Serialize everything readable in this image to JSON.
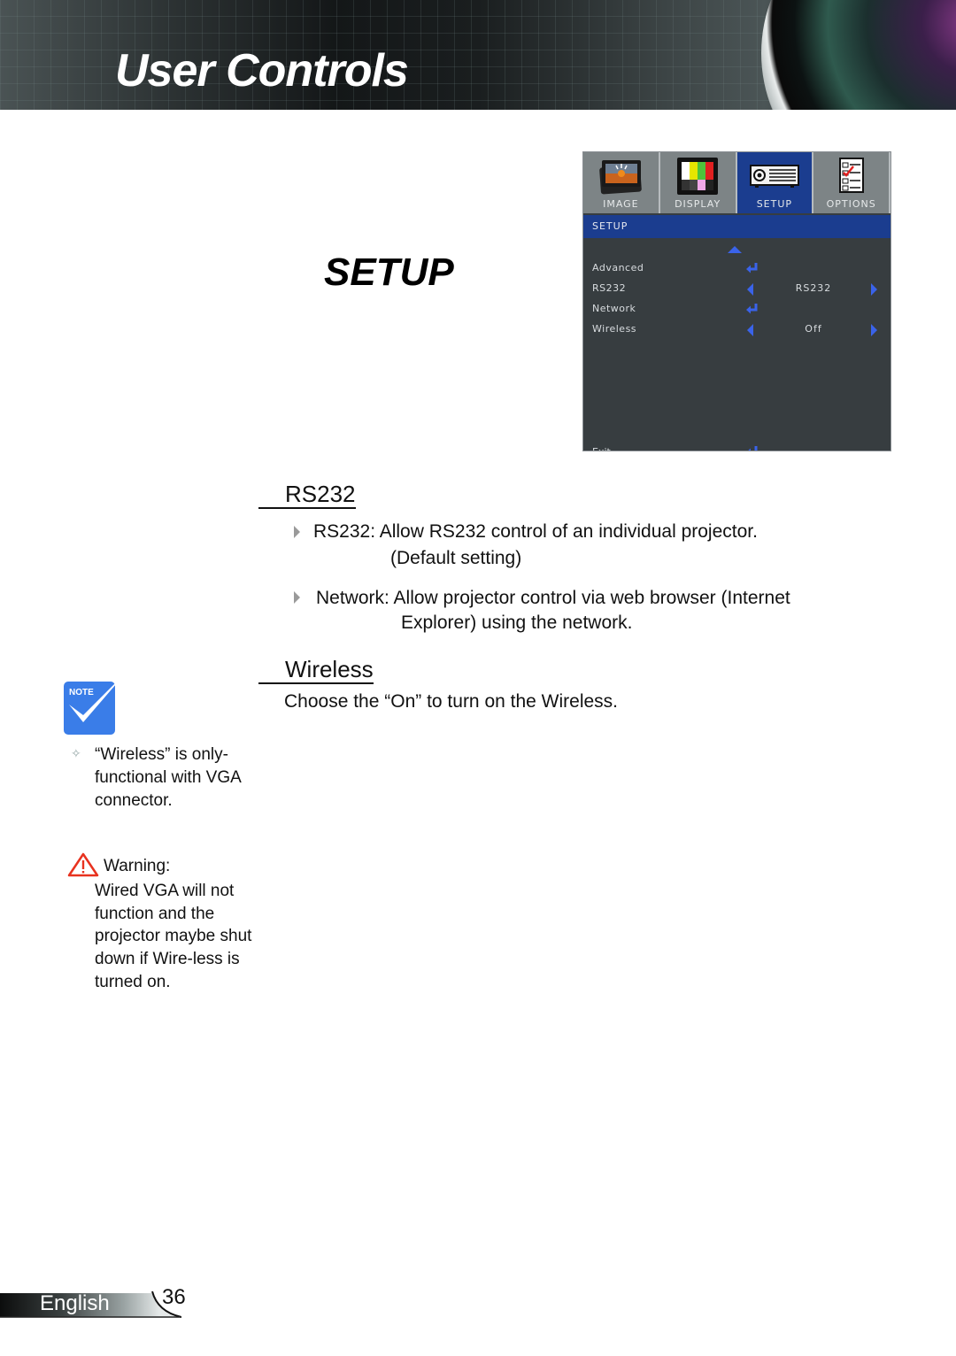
{
  "header": {
    "title": "User Controls"
  },
  "section": {
    "title": "SETUP"
  },
  "osd": {
    "tabs": [
      {
        "label": "IMAGE",
        "icon": "image-icon",
        "active": false
      },
      {
        "label": "DISPLAY",
        "icon": "display-icon",
        "active": false
      },
      {
        "label": "SETUP",
        "icon": "projector-icon",
        "active": true
      },
      {
        "label": "OPTIONS",
        "icon": "checklist-icon",
        "active": false
      }
    ],
    "title_bar": "SETUP",
    "rows": [
      {
        "label": "Advanced",
        "control": "enter"
      },
      {
        "label": "RS232",
        "control": "select",
        "value": "RS232"
      },
      {
        "label": "Network",
        "control": "enter"
      },
      {
        "label": "Wireless",
        "control": "select",
        "value": "Off"
      }
    ],
    "exit_label": "Exit",
    "accent_color": "#1b3d8f",
    "arrow_color": "#3a63ea"
  },
  "rs232": {
    "heading": "RS232",
    "items": [
      {
        "line1": "RS232: Allow RS232 control of an individual projector.",
        "line2": "(Default setting)"
      },
      {
        "line1": "Network: Allow projector control via web browser (Internet",
        "line2": "Explorer) using the network."
      }
    ]
  },
  "wireless": {
    "heading": "Wireless",
    "text": "Choose the “On” to turn on the Wireless."
  },
  "note": {
    "badge": "Note",
    "text": "“Wireless” is only-functional with VGA connector.",
    "warning_title": "Warning:",
    "warning_text": "Wired VGA will not function and the projector maybe shut down if Wire-less is turned on."
  },
  "footer": {
    "language": "English",
    "page_number": "36"
  }
}
